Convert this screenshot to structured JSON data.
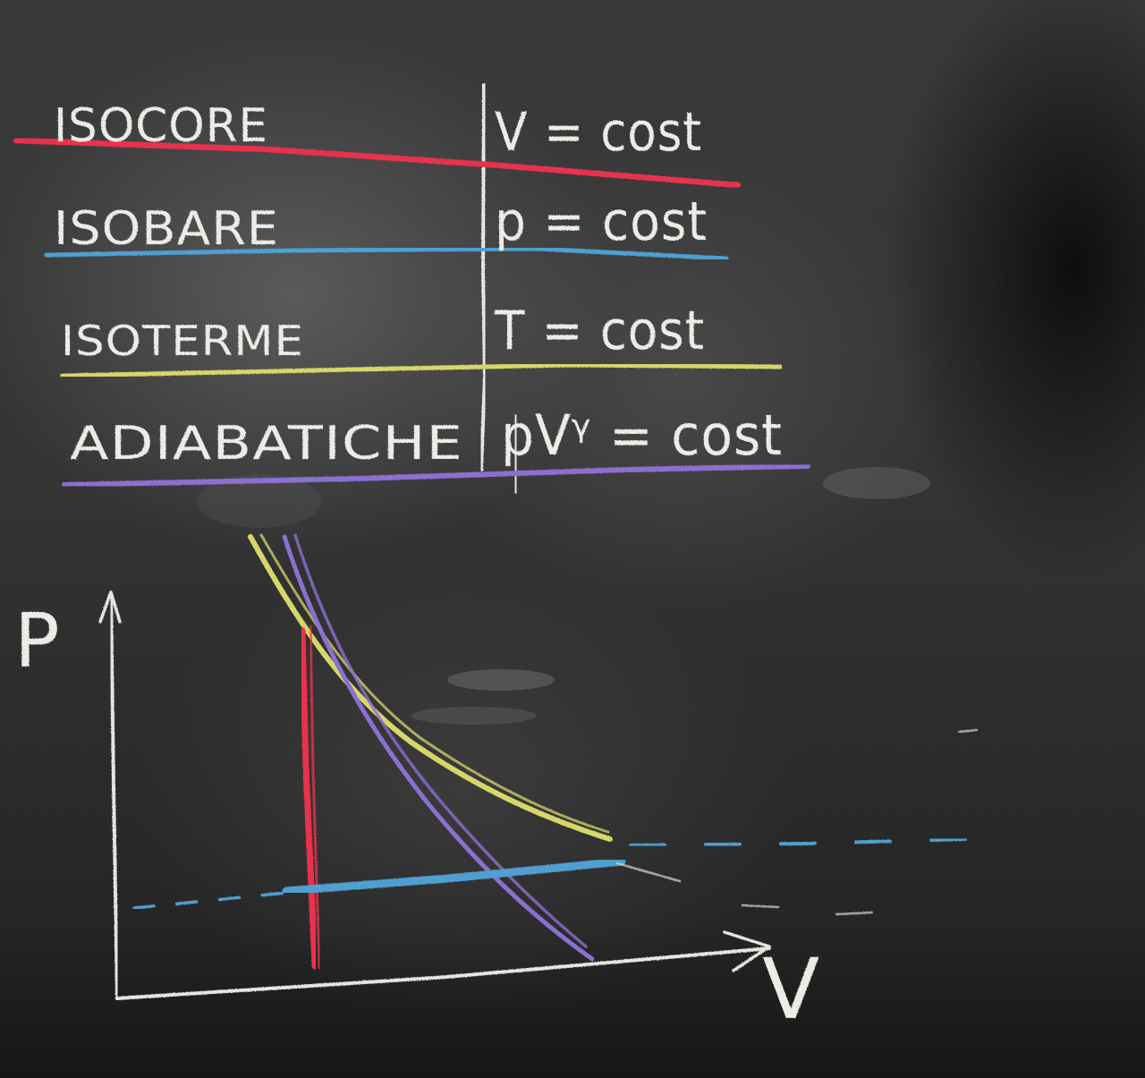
{
  "table": {
    "rows": [
      {
        "name": "ISOCORE",
        "formula": "V = cost",
        "color": "#e8334d"
      },
      {
        "name": "ISOBARE",
        "formula": "p = cost",
        "color": "#4f9fd0"
      },
      {
        "name": "ISOTERME",
        "formula": "T = cost",
        "color": "#d7d66a"
      },
      {
        "name": "ADIABATICHE",
        "formula": "pVᵞ = cost",
        "color": "#8b6fd0"
      }
    ]
  },
  "graph": {
    "y_axis_label": "P",
    "x_axis_label": "V",
    "axis_color": "#e6e6e0"
  }
}
